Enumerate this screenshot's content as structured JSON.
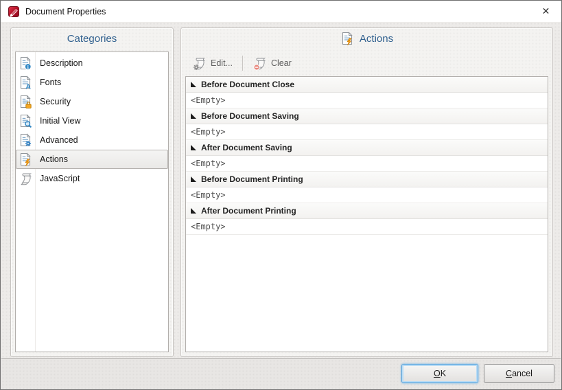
{
  "window": {
    "title": "Document Properties",
    "close_glyph": "✕"
  },
  "categories_panel": {
    "title": "Categories",
    "items": [
      {
        "label": "Description",
        "icon": "description-icon",
        "selected": false
      },
      {
        "label": "Fonts",
        "icon": "fonts-icon",
        "selected": false
      },
      {
        "label": "Security",
        "icon": "security-icon",
        "selected": false
      },
      {
        "label": "Initial View",
        "icon": "initial-view-icon",
        "selected": false
      },
      {
        "label": "Advanced",
        "icon": "advanced-icon",
        "selected": false
      },
      {
        "label": "Actions",
        "icon": "actions-icon",
        "selected": true
      },
      {
        "label": "JavaScript",
        "icon": "javascript-icon",
        "selected": false
      }
    ]
  },
  "actions_panel": {
    "title": "Actions",
    "icon": "actions-icon",
    "toolbar": {
      "edit_label": "Edit...",
      "clear_label": "Clear"
    },
    "groups": [
      {
        "header": "Before Document Close",
        "value": "<Empty>"
      },
      {
        "header": "Before Document Saving",
        "value": "<Empty>"
      },
      {
        "header": "After Document Saving",
        "value": "<Empty>"
      },
      {
        "header": "Before Document Printing",
        "value": "<Empty>"
      },
      {
        "header": "After Document Printing",
        "value": "<Empty>"
      }
    ]
  },
  "footer": {
    "ok_label": "OK",
    "cancel_label": "Cancel"
  },
  "colors": {
    "header_text_blue": "#31618f",
    "title_icon_red": "#b40f26",
    "focus_border_blue": "#56a3dc",
    "badge_blue": "#2f86c4",
    "lock_orange": "#f5a623",
    "lightning_orange": "#f6a31c",
    "clear_badge_red": "#e8897e"
  }
}
